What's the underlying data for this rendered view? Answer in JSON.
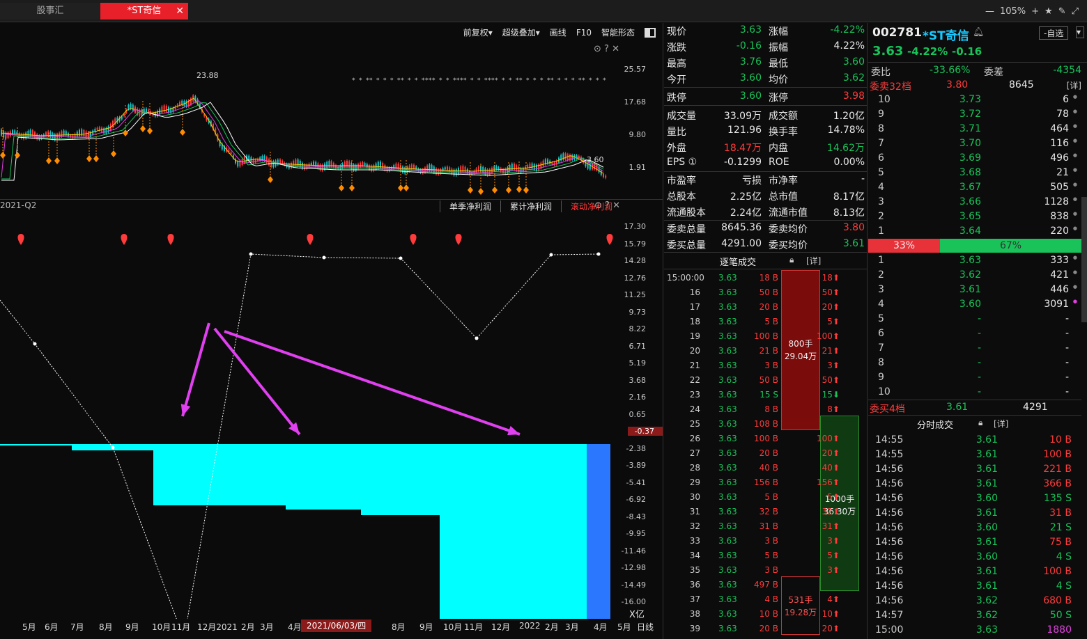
{
  "tabs": [
    "股事汇",
    "*ST奇信"
  ],
  "window": {
    "zoom": "105%"
  },
  "toolbar": [
    "前复权▾",
    "超级叠加▾",
    "画线",
    "F10",
    "智能形态"
  ],
  "upper_chart": {
    "peak_label": "23.88",
    "last_label": "3.60",
    "axis": [
      "25.57",
      "17.68",
      "9.80",
      "1.91"
    ]
  },
  "lower_chart": {
    "period_label": "2021-Q2",
    "tabs": [
      "单季净利润",
      "累计净利润",
      "滚动净利润"
    ],
    "active_tab": "滚动净利润",
    "axis": [
      "17.30",
      "15.79",
      "14.28",
      "12.76",
      "11.25",
      "9.73",
      "8.22",
      "6.71",
      "5.19",
      "3.68",
      "2.16",
      "0.65",
      "-0.37",
      "-2.38",
      "-3.89",
      "-5.41",
      "-6.92",
      "-8.43",
      "-9.95",
      "-11.46",
      "-12.98",
      "-14.49",
      "-16.00"
    ],
    "highlight_value": "-0.37",
    "unit": "X亿"
  },
  "bottom_axis": {
    "labels": [
      "5月",
      "6月",
      "7月",
      "8月",
      "9月",
      "10月",
      "11月",
      "12月2021",
      "2月",
      "3月",
      "4月",
      "8月",
      "9月",
      "10月",
      "11月",
      "12月",
      "2022",
      "2月",
      "3月",
      "4月",
      "5月"
    ],
    "date": "2021/06/03/四",
    "mode": "日线"
  },
  "quote": {
    "rows": [
      [
        "现价",
        "3.63",
        "涨幅",
        "-4.22%"
      ],
      [
        "涨跌",
        "-0.16",
        "振幅",
        "4.22%"
      ],
      [
        "最高",
        "3.76",
        "最低",
        "3.60"
      ],
      [
        "今开",
        "3.60",
        "均价",
        "3.62"
      ],
      [
        "跌停",
        "3.60",
        "涨停",
        "3.98"
      ],
      [
        "成交量",
        "33.09万",
        "成交额",
        "1.20亿"
      ],
      [
        "量比",
        "121.96",
        "换手率",
        "14.78%"
      ],
      [
        "外盘",
        "18.47万",
        "内盘",
        "14.62万"
      ],
      [
        "EPS ①",
        "-0.1299",
        "ROE",
        "0.00%"
      ],
      [
        "市盈率",
        "亏损",
        "市净率",
        "-"
      ],
      [
        "总股本",
        "2.25亿",
        "总市值",
        "8.17亿"
      ],
      [
        "流通股本",
        "2.24亿",
        "流通市值",
        "8.13亿"
      ],
      [
        "委卖总量",
        "8645.36",
        "委卖均价",
        "3.80"
      ],
      [
        "委买总量",
        "4291.00",
        "委买均价",
        "3.61"
      ]
    ],
    "ticks_title": "逐笔成交",
    "detail": "[详]",
    "ticks": [
      [
        "15:00:00",
        "3.63",
        "18 B",
        "18"
      ],
      [
        "16",
        "3.63",
        "50 B",
        "50"
      ],
      [
        "17",
        "3.63",
        "20 B",
        "20"
      ],
      [
        "18",
        "3.63",
        "5 B",
        "5"
      ],
      [
        "19",
        "3.63",
        "100 B",
        "100"
      ],
      [
        "20",
        "3.63",
        "21 B",
        "21"
      ],
      [
        "21",
        "3.63",
        "3 B",
        "3"
      ],
      [
        "22",
        "3.63",
        "50 B",
        "50"
      ],
      [
        "23",
        "3.63",
        "15 S",
        "15"
      ],
      [
        "24",
        "3.63",
        "8 B",
        "8"
      ],
      [
        "25",
        "3.63",
        "108 B",
        ""
      ],
      [
        "26",
        "3.63",
        "100 B",
        "100"
      ],
      [
        "27",
        "3.63",
        "20 B",
        "20"
      ],
      [
        "28",
        "3.63",
        "40 B",
        "40"
      ],
      [
        "29",
        "3.63",
        "156 B",
        "156"
      ],
      [
        "30",
        "3.63",
        "5 B",
        "5"
      ],
      [
        "31",
        "3.63",
        "32 B",
        "32"
      ],
      [
        "32",
        "3.63",
        "31 B",
        "31"
      ],
      [
        "33",
        "3.63",
        "3 B",
        "3"
      ],
      [
        "34",
        "3.63",
        "5 B",
        "5"
      ],
      [
        "35",
        "3.63",
        "3 B",
        "3"
      ],
      [
        "36",
        "3.63",
        "497 B",
        ""
      ],
      [
        "37",
        "3.63",
        "4 B",
        "4"
      ],
      [
        "38",
        "3.63",
        "10 B",
        "10"
      ],
      [
        "39",
        "3.63",
        "20 B",
        "20"
      ]
    ],
    "blocks": [
      {
        "line1": "800手",
        "line2": "29.04万"
      },
      {
        "line1": "1000手",
        "line2": "36.30万"
      },
      {
        "line1": "531手",
        "line2": "19.28万"
      }
    ]
  },
  "book": {
    "code": "002781",
    "name": "*ST奇信",
    "price": "3.63",
    "pct": "-4.22%",
    "chg": "-0.16",
    "add_btn": "-自选",
    "weibi_label": "委比",
    "weibi": "-33.66%",
    "weicha_label": "委差",
    "weicha": "-4354",
    "sell_title": "委卖32档",
    "sell_title_price": "3.80",
    "sell_title_vol": "8645",
    "detail": "[详]",
    "sells": [
      [
        "10",
        "3.73",
        "6"
      ],
      [
        "9",
        "3.72",
        "78"
      ],
      [
        "8",
        "3.71",
        "464"
      ],
      [
        "7",
        "3.70",
        "116"
      ],
      [
        "6",
        "3.69",
        "496"
      ],
      [
        "5",
        "3.68",
        "21"
      ],
      [
        "4",
        "3.67",
        "505"
      ],
      [
        "3",
        "3.66",
        "1128"
      ],
      [
        "2",
        "3.65",
        "838"
      ],
      [
        "1",
        "3.64",
        "220"
      ]
    ],
    "ratio_sell": "33%",
    "ratio_buy": "67%",
    "buys": [
      [
        "1",
        "3.63",
        "333"
      ],
      [
        "2",
        "3.62",
        "421"
      ],
      [
        "3",
        "3.61",
        "446"
      ],
      [
        "4",
        "3.60",
        "3091"
      ],
      [
        "5",
        "-",
        "-"
      ],
      [
        "6",
        "-",
        "-"
      ],
      [
        "7",
        "-",
        "-"
      ],
      [
        "8",
        "-",
        "-"
      ],
      [
        "9",
        "-",
        "-"
      ],
      [
        "10",
        "-",
        "-"
      ]
    ],
    "buy_title": "委买4档",
    "buy_title_price": "3.61",
    "buy_title_vol": "4291",
    "fenshi_title": "分时成交",
    "fenshi": [
      [
        "14:55",
        "3.61",
        "10 B"
      ],
      [
        "14:55",
        "3.61",
        "100 B"
      ],
      [
        "14:56",
        "3.61",
        "221 B"
      ],
      [
        "14:56",
        "3.61",
        "366 B"
      ],
      [
        "14:56",
        "3.60",
        "135 S"
      ],
      [
        "14:56",
        "3.61",
        "31 B"
      ],
      [
        "14:56",
        "3.60",
        "21 S"
      ],
      [
        "14:56",
        "3.61",
        "75 B"
      ],
      [
        "14:56",
        "3.60",
        "4 S"
      ],
      [
        "14:56",
        "3.61",
        "100 B"
      ],
      [
        "14:56",
        "3.61",
        "4 S"
      ],
      [
        "14:56",
        "3.62",
        "680 B"
      ],
      [
        "14:57",
        "3.62",
        "50 S"
      ],
      [
        "15:00",
        "3.63",
        "1880"
      ]
    ]
  }
}
